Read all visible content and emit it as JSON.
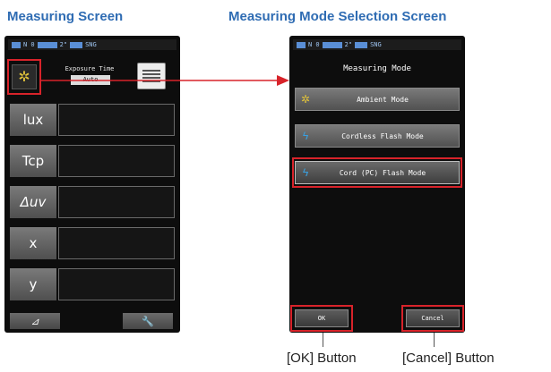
{
  "captions": {
    "left": "Measuring Screen",
    "right": "Measuring Mode Selection Screen"
  },
  "status_bar": {
    "text_a": "N  0",
    "text_b": "2\"",
    "text_c": "SNG"
  },
  "measuring_screen": {
    "exposure_title": "Exposure Time",
    "exposure_value": "Auto",
    "rows": [
      {
        "label": "lux"
      },
      {
        "label": "Tcp"
      },
      {
        "label": "Δuv"
      },
      {
        "label": "x"
      },
      {
        "label": "y"
      }
    ],
    "bottom_left_icon": "delta-icon",
    "bottom_right_icon": "wrench-icon",
    "mode_icon": "sun-icon"
  },
  "mode_screen": {
    "title": "Measuring Mode",
    "items": [
      {
        "label": "Ambient Mode",
        "icon": "sun-icon"
      },
      {
        "label": "Cordless Flash Mode",
        "icon": "flash-icon"
      },
      {
        "label": "Cord (PC) Flash Mode",
        "icon": "flash-icon"
      }
    ],
    "ok_label": "OK",
    "cancel_label": "Cancel"
  },
  "callouts": {
    "ok": "[OK] Button",
    "cancel": "[Cancel] Button"
  },
  "colors": {
    "caption": "#2f6cb3",
    "highlight": "#d8232a",
    "sun": "#e0c23a",
    "flash": "#3aa0e0"
  }
}
